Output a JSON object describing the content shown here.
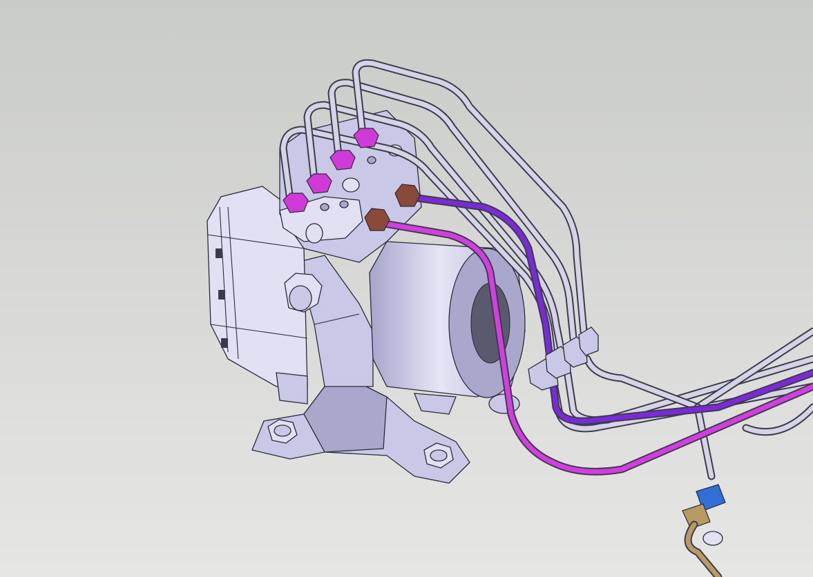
{
  "scene": {
    "background_top": "#c9cbc7",
    "background_bottom": "#e6e6e4",
    "body_color": "#c9c8e6",
    "pipe_color": "#d0d0e4",
    "nut_color_magenta": "#d23ad8",
    "nut_color_brown": "#8a4a3a",
    "line_color_magenta": "#d43ee0",
    "line_color_violet": "#7a2ad8",
    "fitting_color_blue": "#2f6fd6",
    "fitting_color_brass": "#b89a62"
  }
}
